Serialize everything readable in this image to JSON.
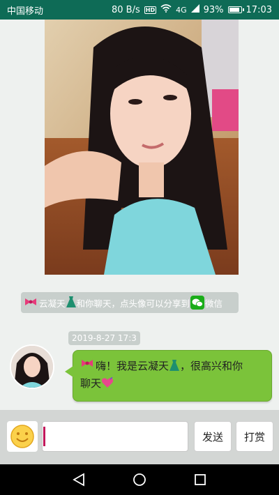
{
  "status_bar": {
    "carrier": "中国移动",
    "speed": "80 B/s",
    "hd_badge": "HD",
    "network": "4G",
    "battery": "93%",
    "time": "17:03",
    "battery_level": 0.93
  },
  "notice": {
    "text_1": "云凝天",
    "text_2": "和你聊天，点头像可以分享到",
    "text_3": "微信",
    "ribbon_icon": "ribbon-emoji",
    "dress_icon": "dress-emoji",
    "wechat_icon": "wechat-icon"
  },
  "message": {
    "timestamp": "2019-8-27 17:3",
    "text_1": "嗨！我是云凝天",
    "text_2": "，很高兴和你",
    "text_3": "聊天",
    "bubble_color": "#7bc33a"
  },
  "input_bar": {
    "input_value": "",
    "send_label": "发送",
    "reward_label": "打赏"
  },
  "colors": {
    "status_bar": "#0e6b56",
    "accent_cursor": "#c2185b"
  }
}
